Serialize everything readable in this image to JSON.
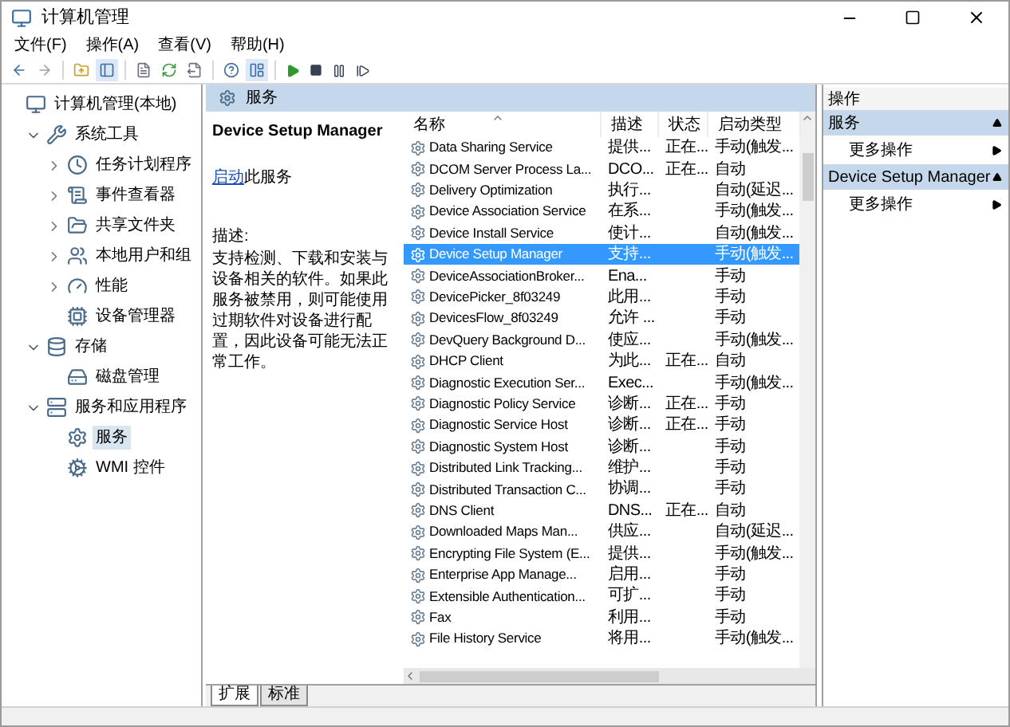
{
  "window": {
    "title": "计算机管理"
  },
  "menu": [
    "文件(F)",
    "操作(A)",
    "查看(V)",
    "帮助(H)"
  ],
  "tree": [
    {
      "label": "计算机管理(本地)",
      "selected": false,
      "children": [
        {
          "label": "系统工具",
          "selected": false,
          "expanded": true,
          "children": [
            {
              "label": "任务计划程序",
              "selected": false,
              "expanded": false
            },
            {
              "label": "事件查看器",
              "selected": false,
              "expanded": false
            },
            {
              "label": "共享文件夹",
              "selected": false,
              "expanded": false
            },
            {
              "label": "本地用户和组",
              "selected": false,
              "expanded": false
            },
            {
              "label": "性能",
              "selected": false,
              "expanded": false
            },
            {
              "label": "设备管理器",
              "selected": false
            }
          ]
        },
        {
          "label": "存储",
          "selected": false,
          "expanded": true,
          "children": [
            {
              "label": "磁盘管理",
              "selected": false
            }
          ]
        },
        {
          "label": "服务和应用程序",
          "selected": false,
          "expanded": true,
          "children": [
            {
              "label": "服务",
              "selected": true
            },
            {
              "label": "WMI 控件",
              "selected": false
            }
          ]
        }
      ]
    }
  ],
  "pane_header": "服务",
  "details": {
    "title": "Device Setup Manager",
    "action_link": "启动",
    "action_rest": "此服务",
    "description_label": "描述:",
    "description": "支持检测、下载和安装与设备相关的软件。如果此服务被禁用，则可能使用过期软件对设备进行配置，因此设备可能无法正常工作。"
  },
  "columns": [
    "名称",
    "描述",
    "状态",
    "启动类型"
  ],
  "rows": [
    {
      "name": "Data Sharing Service",
      "description": "提供...",
      "status": "正在...",
      "startup_type": "手动(触发...",
      "selected": false
    },
    {
      "name": "DCOM Server Process La...",
      "description": "DCO...",
      "status": "正在...",
      "startup_type": "自动",
      "selected": false
    },
    {
      "name": "Delivery Optimization",
      "description": "执行...",
      "status": "",
      "startup_type": "自动(延迟...",
      "selected": false
    },
    {
      "name": "Device Association Service",
      "description": "在系...",
      "status": "",
      "startup_type": "手动(触发...",
      "selected": false
    },
    {
      "name": "Device Install Service",
      "description": "使计...",
      "status": "",
      "startup_type": "自动(触发...",
      "selected": false
    },
    {
      "name": "Device Setup Manager",
      "description": "支持...",
      "status": "",
      "startup_type": "手动(触发...",
      "selected": true
    },
    {
      "name": "DeviceAssociationBroker...",
      "description": "Ena...",
      "status": "",
      "startup_type": "手动",
      "selected": false
    },
    {
      "name": "DevicePicker_8f03249",
      "description": "此用...",
      "status": "",
      "startup_type": "手动",
      "selected": false
    },
    {
      "name": "DevicesFlow_8f03249",
      "description": "允许 ...",
      "status": "",
      "startup_type": "手动",
      "selected": false
    },
    {
      "name": "DevQuery Background D...",
      "description": "使应...",
      "status": "",
      "startup_type": "手动(触发...",
      "selected": false
    },
    {
      "name": "DHCP Client",
      "description": "为此...",
      "status": "正在...",
      "startup_type": "自动",
      "selected": false
    },
    {
      "name": "Diagnostic Execution Ser...",
      "description": "Exec...",
      "status": "",
      "startup_type": "手动(触发...",
      "selected": false
    },
    {
      "name": "Diagnostic Policy Service",
      "description": "诊断...",
      "status": "正在...",
      "startup_type": "手动",
      "selected": false
    },
    {
      "name": "Diagnostic Service Host",
      "description": "诊断...",
      "status": "正在...",
      "startup_type": "手动",
      "selected": false
    },
    {
      "name": "Diagnostic System Host",
      "description": "诊断...",
      "status": "",
      "startup_type": "手动",
      "selected": false
    },
    {
      "name": "Distributed Link Tracking...",
      "description": "维护...",
      "status": "",
      "startup_type": "手动",
      "selected": false
    },
    {
      "name": "Distributed Transaction C...",
      "description": "协调...",
      "status": "",
      "startup_type": "手动",
      "selected": false
    },
    {
      "name": "DNS Client",
      "description": "DNS...",
      "status": "正在...",
      "startup_type": "自动",
      "selected": false
    },
    {
      "name": "Downloaded Maps Man...",
      "description": "供应...",
      "status": "",
      "startup_type": "自动(延迟...",
      "selected": false
    },
    {
      "name": "Encrypting File System (E...",
      "description": "提供...",
      "status": "",
      "startup_type": "手动(触发...",
      "selected": false
    },
    {
      "name": "Enterprise App Manage...",
      "description": "启用...",
      "status": "",
      "startup_type": "手动",
      "selected": false
    },
    {
      "name": "Extensible Authentication...",
      "description": "可扩...",
      "status": "",
      "startup_type": "手动",
      "selected": false
    },
    {
      "name": "Fax",
      "description": "利用...",
      "status": "",
      "startup_type": "手动",
      "selected": false
    },
    {
      "name": "File History Service",
      "description": "将用...",
      "status": "",
      "startup_type": "手动(触发...",
      "selected": false
    }
  ],
  "view_tabs": [
    {
      "label": "扩展",
      "selected": true
    },
    {
      "label": "标准",
      "selected": false
    }
  ],
  "actions": {
    "title": "操作",
    "sections": [
      {
        "title": "服务",
        "items": [
          "更多操作"
        ]
      },
      {
        "title": "Device Setup Manager",
        "items": [
          "更多操作"
        ]
      }
    ]
  }
}
